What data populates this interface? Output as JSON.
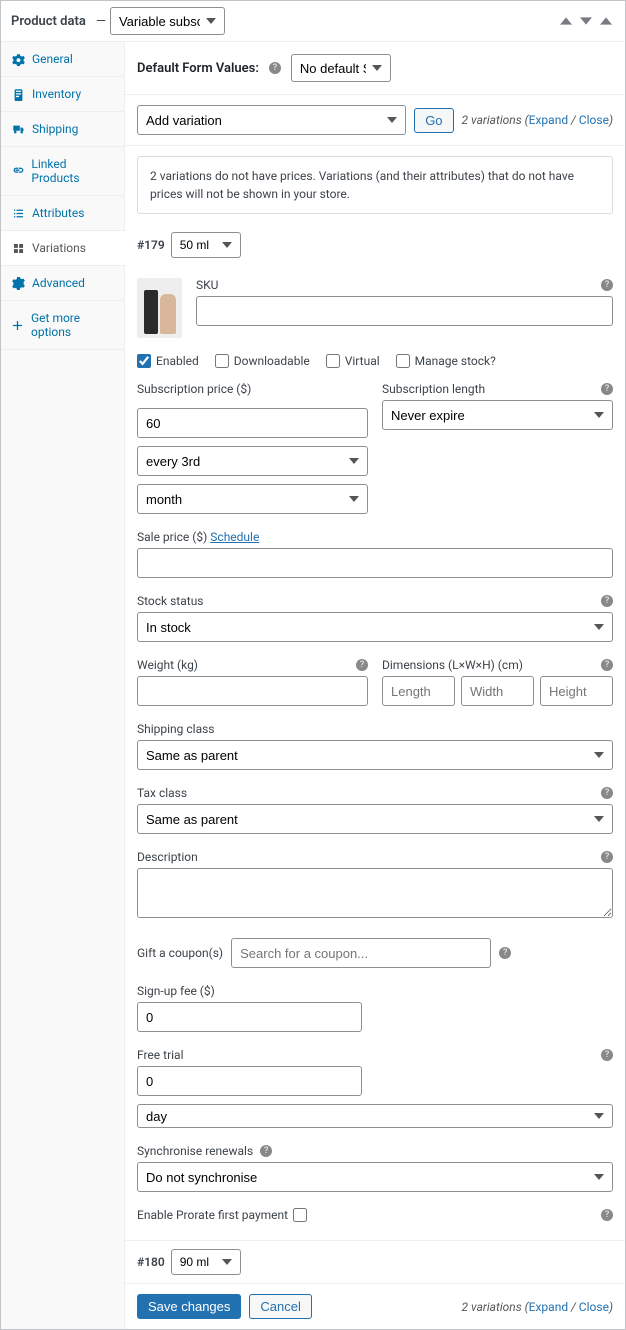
{
  "header": {
    "title": "Product data",
    "dash": "—",
    "product_type": "Variable subscription"
  },
  "sidebar": {
    "items": [
      {
        "label": "General"
      },
      {
        "label": "Inventory"
      },
      {
        "label": "Shipping"
      },
      {
        "label": "Linked Products"
      },
      {
        "label": "Attributes"
      },
      {
        "label": "Variations"
      },
      {
        "label": "Advanced"
      },
      {
        "label": "Get more options"
      }
    ]
  },
  "defaults": {
    "label": "Default Form Values:",
    "value": "No default Sizes..."
  },
  "actions": {
    "add_variation": "Add variation",
    "go": "Go",
    "count_text": "2 variations",
    "expand": "Expand",
    "close": "Close"
  },
  "warning": "2 variations do not have prices. Variations (and their attributes) that do not have prices will not be shown in your store.",
  "variation179": {
    "id": "#179",
    "size": "50 ml",
    "sku_label": "SKU",
    "sku_value": "",
    "enabled": "Enabled",
    "downloadable": "Downloadable",
    "virtual": "Virtual",
    "manage_stock": "Manage stock?",
    "sub_price_label": "Subscription price ($)",
    "sub_price_value": "60",
    "interval_value": "every 3rd",
    "period_value": "month",
    "sub_length_label": "Subscription length",
    "sub_length_value": "Never expire",
    "sale_price_label": "Sale price ($)",
    "schedule": "Schedule",
    "sale_price_value": "",
    "stock_label": "Stock status",
    "stock_value": "In stock",
    "weight_label": "Weight (kg)",
    "weight_value": "",
    "dim_label": "Dimensions (L×W×H) (cm)",
    "dim_l": "Length",
    "dim_w": "Width",
    "dim_h": "Height",
    "ship_label": "Shipping class",
    "ship_value": "Same as parent",
    "tax_label": "Tax class",
    "tax_value": "Same as parent",
    "desc_label": "Description",
    "desc_value": "",
    "gift_label": "Gift a coupon(s)",
    "gift_placeholder": "Search for a coupon...",
    "signup_label": "Sign-up fee ($)",
    "signup_value": "0",
    "trial_label": "Free trial",
    "trial_value": "0",
    "trial_period": "day",
    "sync_label": "Synchronise renewals",
    "sync_value": "Do not synchronise",
    "prorate_label": "Enable Prorate first payment"
  },
  "variation180": {
    "id": "#180",
    "size": "90 ml"
  },
  "footer": {
    "save": "Save changes",
    "cancel": "Cancel"
  }
}
